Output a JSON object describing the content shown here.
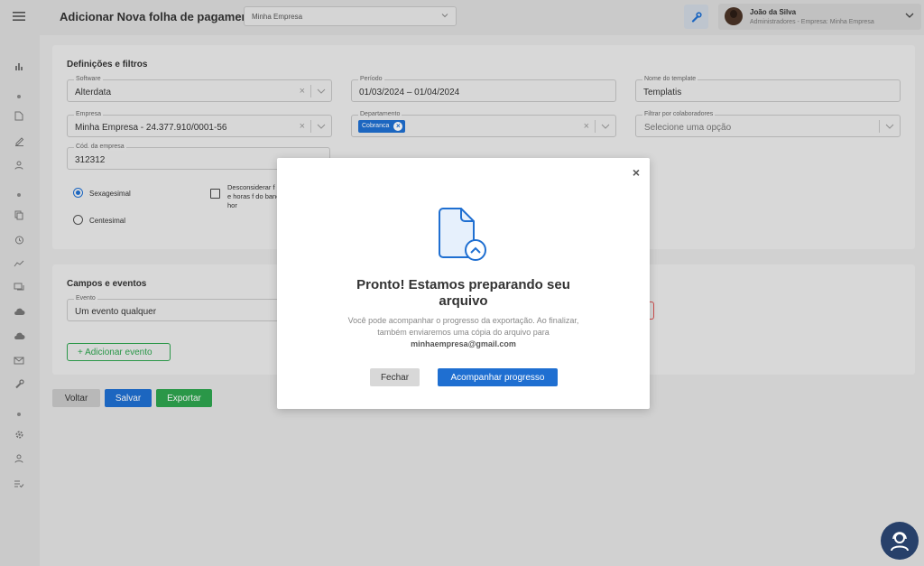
{
  "header": {
    "title": "Adicionar Nova folha de pagamento",
    "company_select": "Minha Empresa",
    "user": {
      "name": "João da Silva",
      "role": "Administradores - Empresa: Minha Empresa"
    }
  },
  "definitions": {
    "title": "Definições e filtros",
    "software": {
      "label": "Software",
      "value": "Alterdata"
    },
    "periodo": {
      "label": "Período",
      "value": "01/03/2024 – 01/04/2024"
    },
    "template": {
      "label": "Nome do template",
      "value": "Templatis"
    },
    "empresa": {
      "label": "Empresa",
      "value": "Minha Empresa - 24.377.910/0001-56"
    },
    "departamento": {
      "label": "Departamento",
      "chip": "Cobranca"
    },
    "colaboradores": {
      "label": "Filtrar por colaboradores",
      "placeholder": "Selecione uma opção"
    },
    "cod_empresa": {
      "label": "Cód. da empresa",
      "value": "312312"
    },
    "radio_sexagesimal": "Sexagesimal",
    "radio_centesimal": "Centesimal",
    "checkbox_text": "Desconsiderar f extras e horas f do banco de hor"
  },
  "campos": {
    "title": "Campos e eventos",
    "evento": {
      "label": "Evento",
      "value": "Um evento qualquer"
    },
    "add_label": "+ Adicionar evento"
  },
  "actions": {
    "voltar": "Voltar",
    "salvar": "Salvar",
    "exportar": "Exportar"
  },
  "modal": {
    "title": "Pronto! Estamos preparando seu arquivo",
    "text_1": "Você pode acompanhar o progresso da exportação. Ao finalizar, também enviaremos uma cópia do arquivo para",
    "email": "minhaempresa@gmail.com",
    "close_label": "Fechar",
    "track_label": "Acompanhar progresso",
    "close_icon": "×"
  },
  "colors": {
    "primary": "#1f6fd1",
    "success": "#2ea44f",
    "help": "#27406a"
  }
}
